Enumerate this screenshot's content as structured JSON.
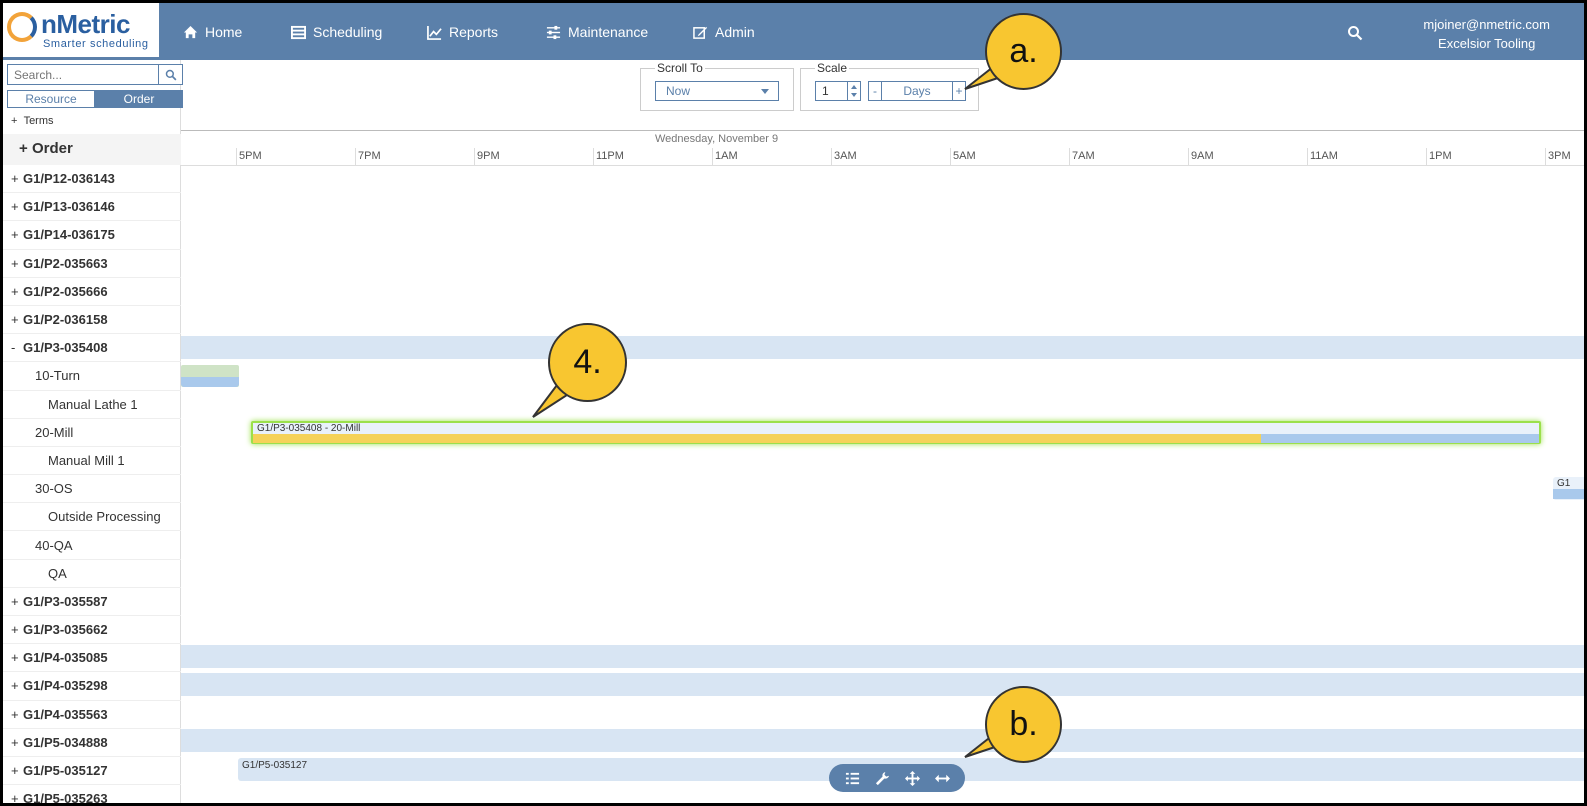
{
  "app": {
    "logo_name": "nMetric",
    "logo_tagline": "Smarter scheduling",
    "user_email": "mjoiner@nmetric.com",
    "company": "Excelsior Tooling"
  },
  "nav": {
    "home": "Home",
    "scheduling": "Scheduling",
    "reports": "Reports",
    "maintenance": "Maintenance",
    "admin": "Admin"
  },
  "left_panel": {
    "search_placeholder": "Search...",
    "toggle_resource": "Resource",
    "toggle_order": "Order",
    "terms_label": "Terms",
    "order_header": "Order",
    "rows": [
      {
        "type": "order",
        "toggle": "+",
        "label": "G1/P12-036143"
      },
      {
        "type": "order",
        "toggle": "+",
        "label": "G1/P13-036146"
      },
      {
        "type": "order",
        "toggle": "+",
        "label": "G1/P14-036175"
      },
      {
        "type": "order",
        "toggle": "+",
        "label": "G1/P2-035663"
      },
      {
        "type": "order",
        "toggle": "+",
        "label": "G1/P2-035666"
      },
      {
        "type": "order",
        "toggle": "+",
        "label": "G1/P2-036158"
      },
      {
        "type": "order",
        "toggle": "-",
        "label": "G1/P3-035408"
      },
      {
        "type": "op",
        "label": "10-Turn"
      },
      {
        "type": "res",
        "label": "Manual Lathe 1"
      },
      {
        "type": "op",
        "label": "20-Mill"
      },
      {
        "type": "res",
        "label": "Manual Mill 1"
      },
      {
        "type": "op",
        "label": "30-OS"
      },
      {
        "type": "res",
        "label": "Outside Processing"
      },
      {
        "type": "op",
        "label": "40-QA"
      },
      {
        "type": "res",
        "label": "QA"
      },
      {
        "type": "order",
        "toggle": "+",
        "label": "G1/P3-035587"
      },
      {
        "type": "order",
        "toggle": "+",
        "label": "G1/P3-035662"
      },
      {
        "type": "order",
        "toggle": "+",
        "label": "G1/P4-035085"
      },
      {
        "type": "order",
        "toggle": "+",
        "label": "G1/P4-035298"
      },
      {
        "type": "order",
        "toggle": "+",
        "label": "G1/P4-035563"
      },
      {
        "type": "order",
        "toggle": "+",
        "label": "G1/P5-034888"
      },
      {
        "type": "order",
        "toggle": "+",
        "label": "G1/P5-035127"
      },
      {
        "type": "order",
        "toggle": "+",
        "label": "G1/P5-035263"
      }
    ]
  },
  "toolbar": {
    "scroll_to_label": "Scroll To",
    "scroll_to_value": "Now",
    "scale_label": "Scale",
    "scale_value": "1",
    "scale_unit": "Days",
    "minus": "-",
    "plus": "+"
  },
  "gantt": {
    "date_label": "Wednesday, November 9",
    "hours": [
      "5PM",
      "7PM",
      "9PM",
      "11PM",
      "1AM",
      "3AM",
      "5AM",
      "7AM",
      "9AM",
      "11AM",
      "1PM",
      "3PM"
    ],
    "mill_bar_label": "G1/P3-035408 - 20-Mill",
    "p5_bar_label": "G1/P5-035127",
    "edge_bar_label": "G1"
  },
  "callouts": {
    "a": "a.",
    "b": "b.",
    "four": "4."
  },
  "colors": {
    "nav_bg": "#5b80aa",
    "band": "#d8e5f3",
    "progress_yellow": "#f5d259",
    "remaining_blue": "#a9c9ec",
    "highlight_green": "#9be04b",
    "callout_yellow": "#f8c630"
  }
}
